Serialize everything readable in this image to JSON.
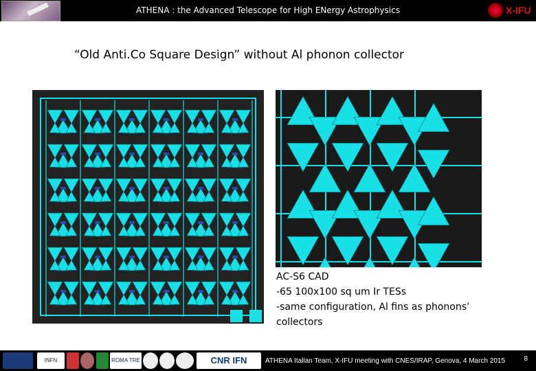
{
  "header": {
    "title": "ATHENA : the Advanced Telescope for High ENergy Astrophysics",
    "right_logo_text": "X-IFU"
  },
  "slide": {
    "subtitle": "“Old Anti.Co Square Design” without Al phonon collector",
    "caption_lines": [
      "AC-S6 CAD",
      "-65 100x100 sq um Ir TESs",
      "-same configuration, Al fins as phonons’",
      "collectors"
    ]
  },
  "footer": {
    "text": "ATHENA Italian Team, X-IFU meeting with CNES/IRAP, Genova, 4 March 2015",
    "logo_text_cnr": "CNR IFN",
    "logo_text_infn": "INFN",
    "logo_text_roma": "ROMA TRE",
    "page_number": "8"
  },
  "colors": {
    "cad_cyan": "#19e0e6",
    "cad_bg": "#222222",
    "bar_bg": "#000000"
  }
}
